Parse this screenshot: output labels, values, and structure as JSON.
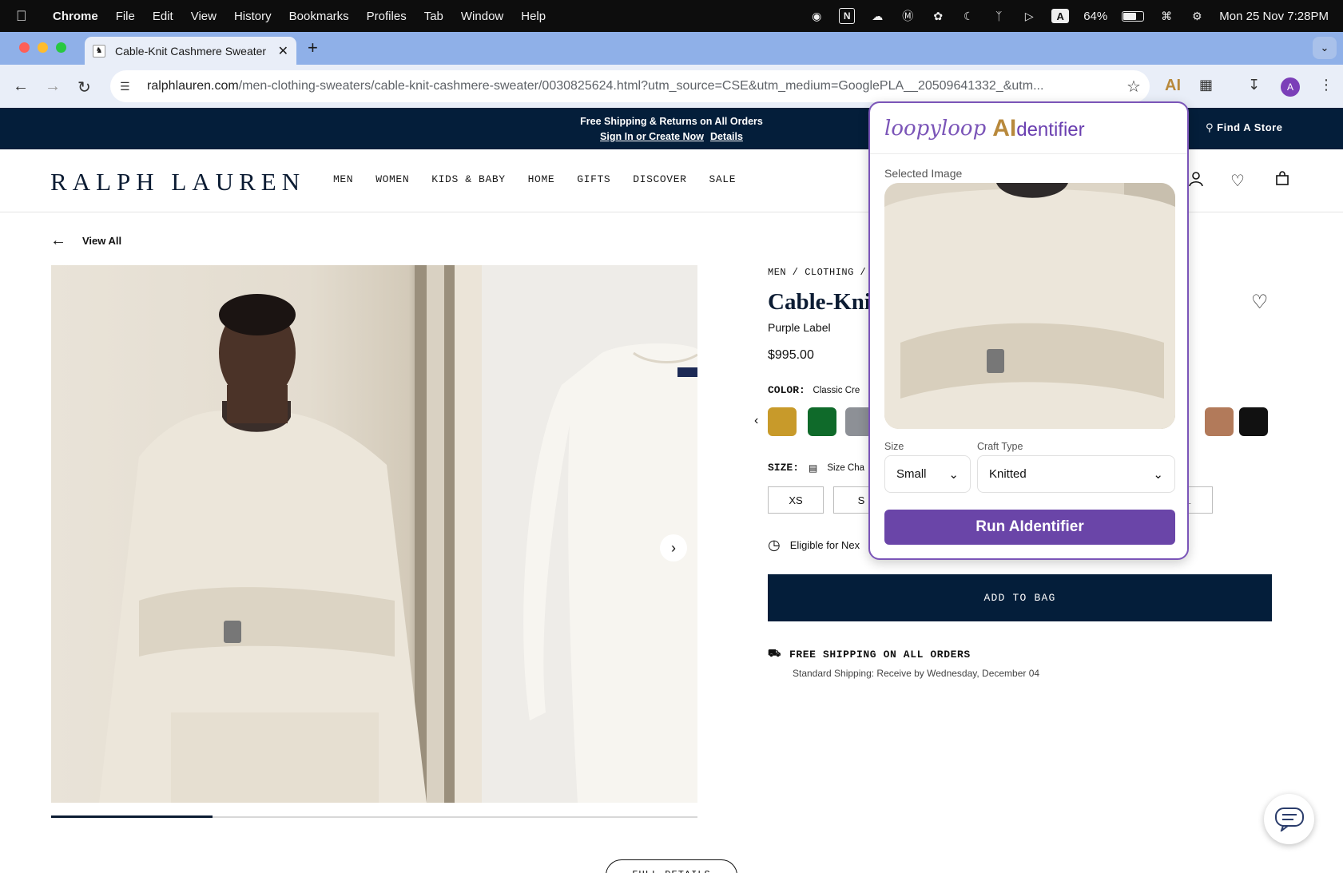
{
  "menubar": {
    "app": "Chrome",
    "items": [
      "File",
      "Edit",
      "View",
      "History",
      "Bookmarks",
      "Profiles",
      "Tab",
      "Window",
      "Help"
    ],
    "battery": "64%",
    "datetime": "Mon 25 Nov  7:28PM",
    "input_source": "A"
  },
  "browser": {
    "tab_title": "Cable-Knit Cashmere Sweater",
    "url_domain": "ralphlauren.com",
    "url_path": "/men-clothing-sweaters/cable-knit-cashmere-sweater/0030825624.html?utm_source=CSE&utm_medium=GooglePLA__20509641332_&utm...",
    "profile_initial": "A",
    "extension_label": "AI"
  },
  "promo": {
    "line1": "Free Shipping & Returns on All Orders",
    "signin": "Sign In or Create Now",
    "details": "Details",
    "find_store": "Find A Store"
  },
  "header": {
    "logo": "RALPH LAUREN",
    "nav": [
      "MEN",
      "WOMEN",
      "KIDS & BABY",
      "HOME",
      "GIFTS",
      "DISCOVER",
      "SALE"
    ]
  },
  "product": {
    "view_all": "View All",
    "breadcrumb": "MEN / CLOTHING /",
    "title": "Cable-Kni",
    "label": "Purple Label",
    "price": "$995.00",
    "color_label": "COLOR:",
    "color_value": "Classic Cre",
    "size_label": "SIZE:",
    "size_chart": "Size Cha",
    "sizes": [
      "XS",
      "S",
      "XL"
    ],
    "eligible": "Eligible for Nex",
    "add_to_bag": "ADD TO BAG",
    "shipping_title": "FREE SHIPPING ON ALL ORDERS",
    "shipping_note": "Standard Shipping: Receive by Wednesday, December 04",
    "full_details": "FULL DETAILS",
    "swatch_colors": [
      "#c89a2a",
      "#0f6a2a",
      "#8d9096",
      "#1b2440",
      "#b27a5a",
      "#111111"
    ],
    "image_progress": 0.25
  },
  "popup": {
    "brand_script": "loopyloop",
    "brand_ai": "AI",
    "brand_rest": "dentifier",
    "selected_image_label": "Selected Image",
    "size_label": "Size",
    "size_value": "Small",
    "craft_label": "Craft Type",
    "craft_value": "Knitted",
    "run_button": "Run AIdentifier"
  }
}
